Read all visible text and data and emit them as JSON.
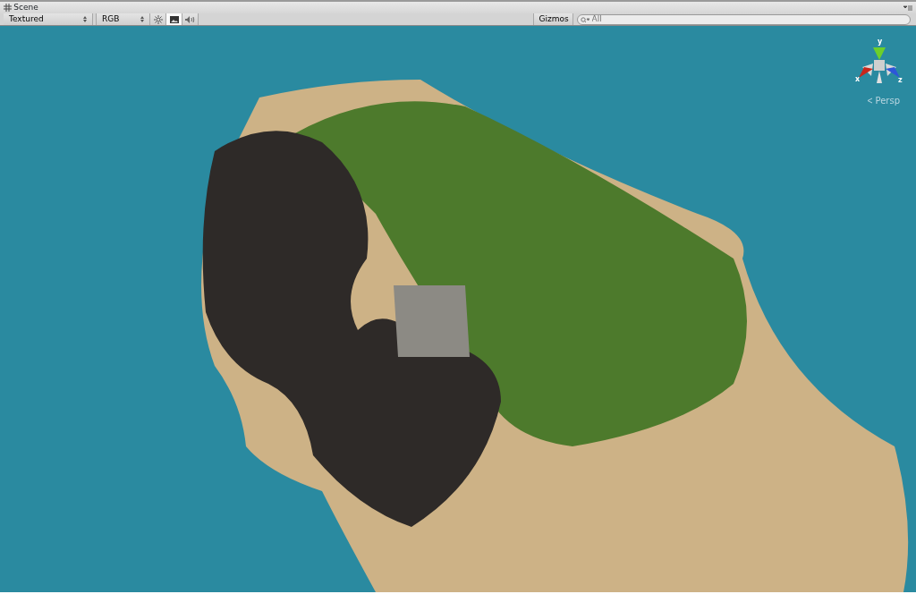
{
  "window": {
    "title": "Scene"
  },
  "toolbar": {
    "draw_mode": "Textured",
    "render_mode": "RGB",
    "toggles": [
      {
        "kind": "lighting",
        "selected": false
      },
      {
        "kind": "game-overlay",
        "selected": true
      },
      {
        "kind": "audio",
        "selected": false
      }
    ],
    "gizmos": "Gizmos",
    "search": {
      "placeholder": "All"
    }
  },
  "viewport": {
    "gizmo": {
      "axes": [
        {
          "label": "y"
        },
        {
          "label": "x"
        },
        {
          "label": "z"
        }
      ]
    },
    "projection": "Persp"
  }
}
